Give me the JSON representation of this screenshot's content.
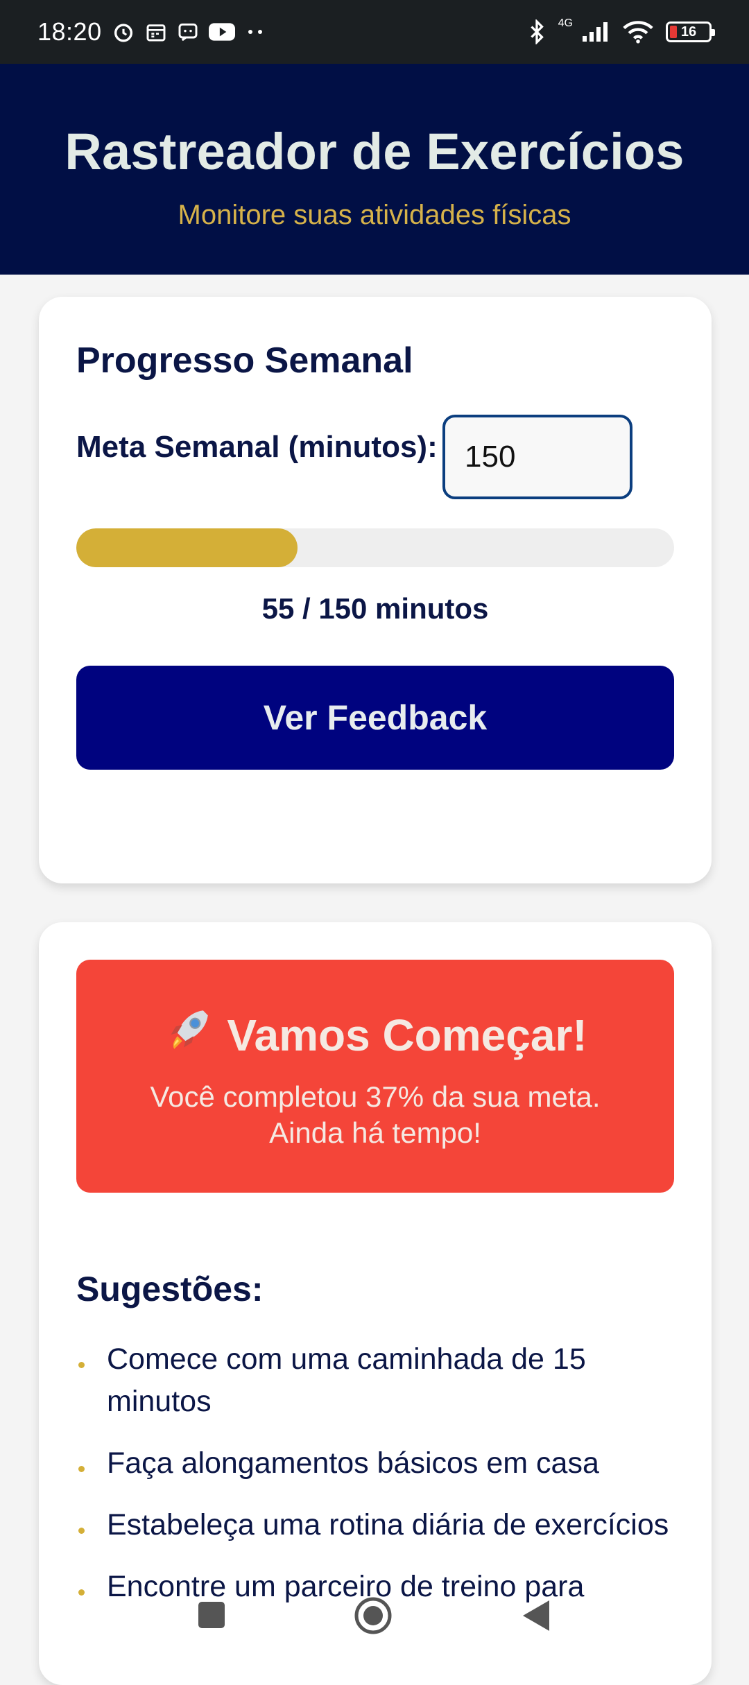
{
  "status_bar": {
    "time": "18:20",
    "network": "4G",
    "battery": "16",
    "icons": [
      "alarm-icon",
      "calendar-icon",
      "message-icon",
      "youtube-icon",
      "more-dots-icon",
      "bluetooth-icon",
      "signal-icon",
      "wifi-icon",
      "battery-icon"
    ]
  },
  "header": {
    "title": "Rastreador de Exercícios",
    "subtitle": "Monitore suas atividades físicas"
  },
  "progress": {
    "section_title": "Progresso Semanal",
    "goal_label": "Meta Semanal (minutos):",
    "goal_value": "150",
    "completed": 55,
    "goal": 150,
    "progress_fraction": 0.37,
    "progress_text": "55 / 150 minutos",
    "button_label": "Ver Feedback"
  },
  "feedback": {
    "title": "Vamos Começar!",
    "message": "Você completou 37% da sua meta. Ainda há tempo!",
    "color": "#f44539"
  },
  "suggestions": {
    "title": "Sugestões:",
    "items": [
      "Comece com uma caminhada de 15 minutos",
      "Faça alongamentos básicos em casa",
      "Estabeleça uma rotina diária de exercícios",
      "Encontre um parceiro de treino para"
    ]
  },
  "colors": {
    "header_bg": "#010f45",
    "accent_gold": "#d4af37",
    "button_bg": "#00037f"
  },
  "nav": {
    "icons": [
      "recent-apps-icon",
      "home-icon",
      "back-icon"
    ]
  }
}
